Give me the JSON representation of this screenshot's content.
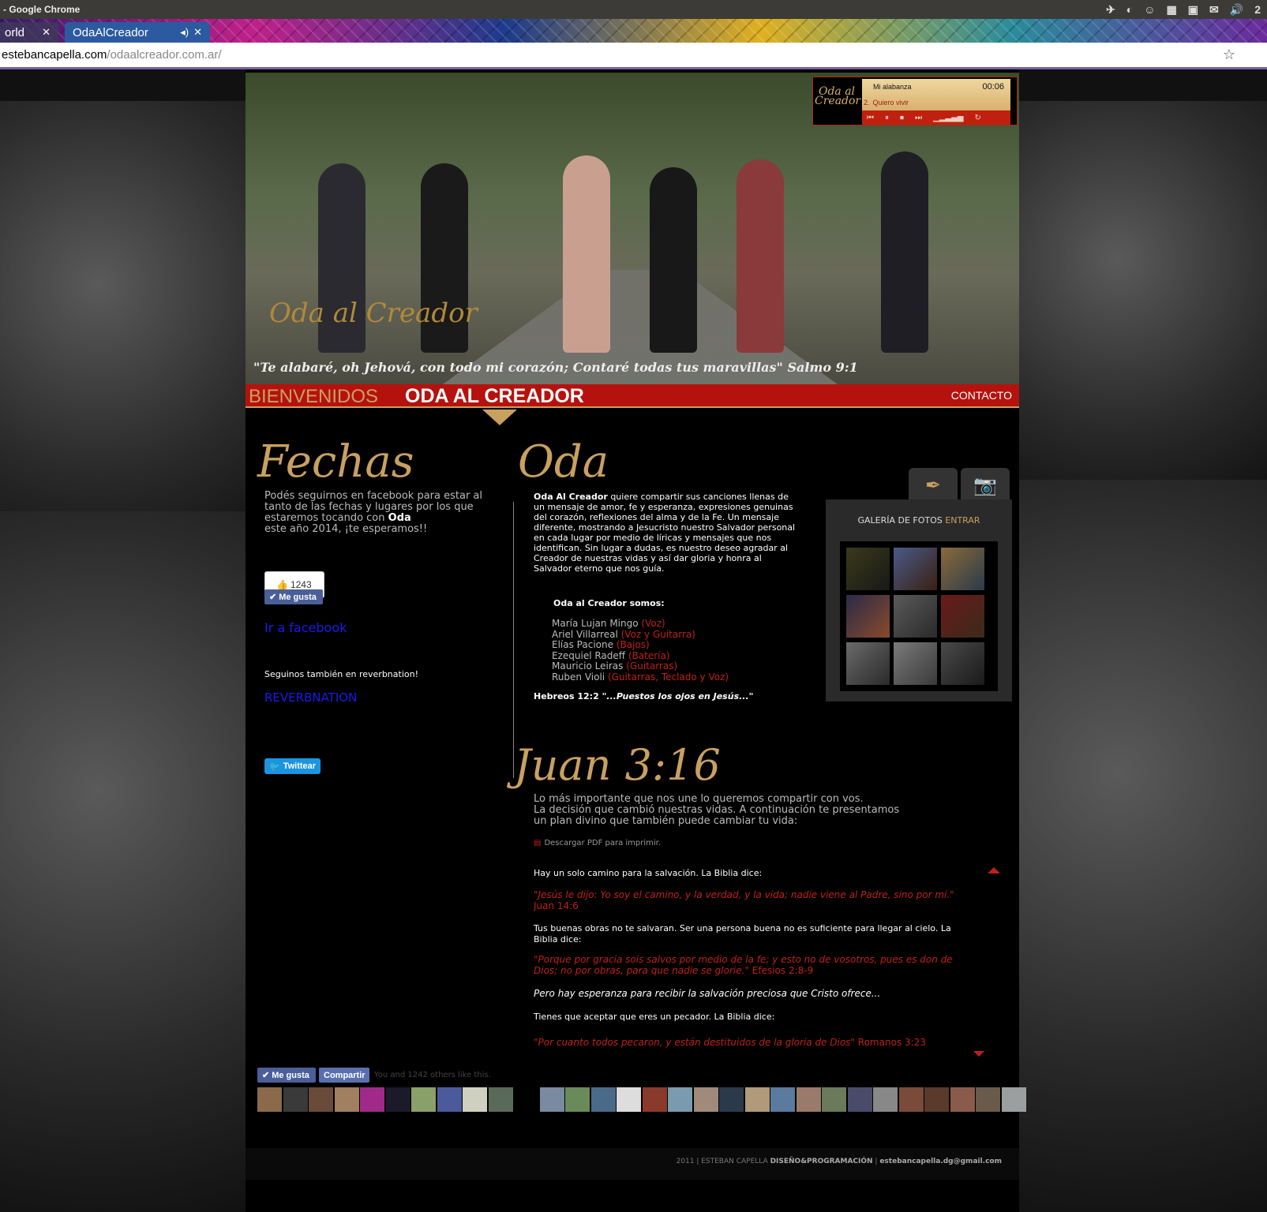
{
  "os": {
    "title": "- Google Chrome",
    "tray": [
      "✈",
      "◐",
      "☺",
      "▦",
      "▣",
      "✉",
      "🔊",
      "2"
    ]
  },
  "browser": {
    "tabs": [
      {
        "label": "orld"
      },
      {
        "label": "OdaAlCreador"
      }
    ],
    "url_host": "estebancapella.com",
    "url_path": "/odaalcreador.com.ar/"
  },
  "player": {
    "logo": "Oda al Creador",
    "tracks": [
      {
        "num": "",
        "title": "Mi alabanza",
        "time": "00:06"
      },
      {
        "num": "2.",
        "title": "Quiero vivir",
        "time": ""
      }
    ]
  },
  "hero": {
    "logo": "Oda al Creador",
    "quote": "\"Te alabaré, oh Jehová, con todo mi corazón; Contaré todas tus maravillas\" Salmo 9:1"
  },
  "nav": {
    "welcome": "BIENVENIDOS",
    "band": "ODA AL CREADOR",
    "contact": "CONTACTO"
  },
  "fechas": {
    "title": "Fechas",
    "text": "Podés seguirnos en facebook para estar al tanto de las fechas y lugares por los que estaremos tocando con",
    "strong": "Oda",
    "text_end": "este año 2014, ¡te esperamos!!",
    "like_count": "1243",
    "like_btn": "Me gusta",
    "fb_link": "Ir a facebook",
    "reverb_text": "Seguinos también en reverbnation!",
    "reverb_link": "REVERBNATION",
    "tweet": "Twittear"
  },
  "oda": {
    "title": "Oda",
    "strong": "Oda Al Creador",
    "text": "quiere compartir sus canciones llenas de un mensaje de amor, fe y esperanza, expresiones genuinas del corazón, reflexiones del alma y de la Fe. Un mensaje diferente, mostrando a Jesucristo nuestro Salvador personal en cada lugar por medio de líricas y mensajes que nos identifican. Sin lugar a dudas, es nuestro deseo agradar al Creador de nuestras vidas y así dar gloria y honra al Salvador eterno que nos guía.",
    "somos": "Oda al Creador somos:",
    "members": [
      {
        "name": "María Lujan Mingo",
        "role": "(Voz)"
      },
      {
        "name": "Ariel Villarreal",
        "role": "(Voz y Guitarra)"
      },
      {
        "name": "Elías Pacione",
        "role": "(Bajos)"
      },
      {
        "name": "Ezequiel Radeff",
        "role": "(Batería)"
      },
      {
        "name": "Mauricio Leiras",
        "role": "(Guitarras)"
      },
      {
        "name": "Ruben Violi",
        "role": "(Guitarras, Teclado y Voz)"
      }
    ],
    "verse_ref": "Hebreos 12:2",
    "verse": "\"...Puestos los ojos en Jesús...\""
  },
  "gallery": {
    "label": "GALERÍA DE FOTOS",
    "enter": "ENTRAR"
  },
  "juan": {
    "title": "Juan 3:16",
    "intro": [
      "Lo más importante que nos une lo queremos compartir con vos.",
      "La decisión que cambió nuestras vidas. A continuación te presentamos",
      "un plan divino que también puede cambiar tu vida:"
    ],
    "pdf": "Descargar PDF para imprimir.",
    "p1": "Hay un solo camino para la salvación. La Biblia dice:",
    "q1": "\"Jesús le dijo: Yo soy el camino, y la verdad, y la vida; nadie viene al Padre, sino por mí.\"",
    "q1_ref": "Juan 14:6",
    "p2": "Tus buenas obras no te salvaran. Ser una persona buena no es suficiente para llegar al cielo. La Biblia dice:",
    "q2": "\"Porque por gracia sois salvos por medio de la fe; y esto no de vosotros, pues es don de Dios; no por obras, para que nadie se glorie.\"",
    "q2_ref": "Efesios 2:8-9",
    "p3": "Pero hay esperanza para recibir la salvación preciosa que Cristo ofrece...",
    "p4": "Tienes que aceptar que eres un pecador. La Biblia dice:",
    "q3": "\"Por cuanto todos pecaron, y están destituidos de la gloria de Dios\"",
    "q3_ref": "Romanos 3:23"
  },
  "bottom_fb": {
    "like": "Me gusta",
    "share": "Compartir",
    "others": "You and 1242 others like this."
  },
  "footer": {
    "year": "2011 | ESTEBAN CAPELLA",
    "design": "DISEÑO&PROGRAMACIÓN",
    "email": "estebancapella.dg@gmail.com"
  }
}
